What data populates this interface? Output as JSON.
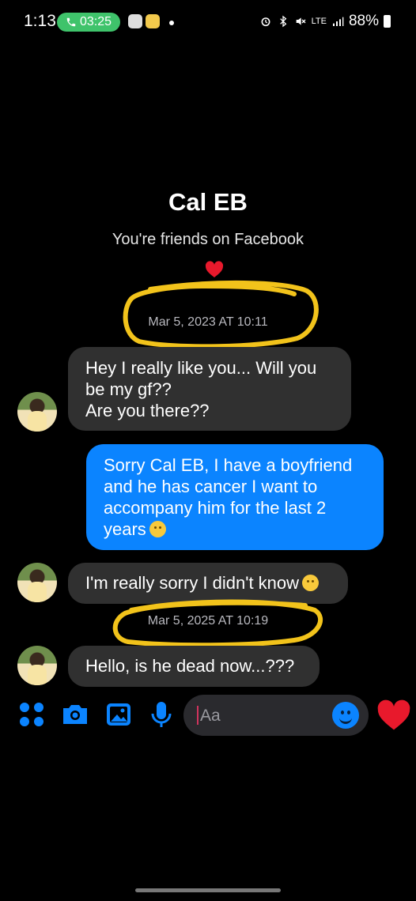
{
  "status_bar": {
    "time": "1:13",
    "call_timer": "03:25",
    "network": "LTE",
    "battery": "88%"
  },
  "conversation": {
    "contact_name": "Cal EB",
    "friends_note": "You're friends on Facebook",
    "separators": [
      {
        "label": "Mar 5, 2023 AT 10:11"
      },
      {
        "label": "Mar 5, 2025 AT 10:19"
      }
    ],
    "messages": [
      {
        "direction": "incoming",
        "lines": [
          "Hey I really like you... Will you",
          "be my gf??",
          "Are you there??"
        ]
      },
      {
        "direction": "outgoing",
        "lines": [
          "Sorry Cal EB, I have a boyfriend",
          "and he has cancer I want to",
          "accompany him for the last 2",
          "years"
        ],
        "emoji": "sad-face"
      },
      {
        "direction": "incoming",
        "lines": [
          "I'm really sorry I didn't know"
        ],
        "emoji": "smiling-face"
      },
      {
        "direction": "incoming",
        "lines": [
          "Hello, is he dead now...???"
        ]
      }
    ]
  },
  "composer": {
    "placeholder": "Aa",
    "icons": [
      "more-apps-icon",
      "camera-icon",
      "gallery-icon",
      "microphone-icon",
      "emoji-icon",
      "heart-like-icon"
    ]
  },
  "colors": {
    "background": "#000000",
    "incoming_bubble": "#303030",
    "outgoing_bubble": "#0b84ff",
    "highlight_marker": "#f2c31b",
    "accent": "#0b84ff",
    "heart": "#e8192c"
  }
}
